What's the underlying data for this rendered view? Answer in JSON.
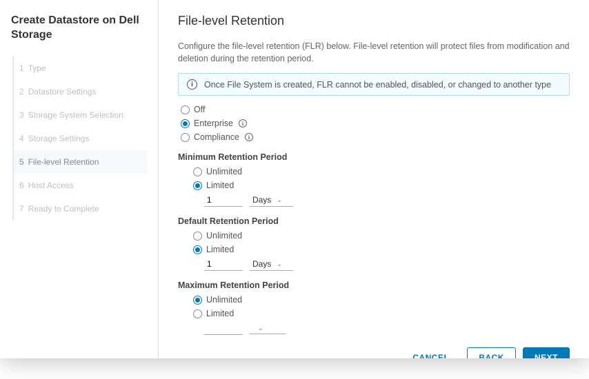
{
  "wizard_title": "Create Datastore on Dell Storage",
  "steps": [
    {
      "num": "1",
      "label": "Type"
    },
    {
      "num": "2",
      "label": "Datastore Settings"
    },
    {
      "num": "3",
      "label": "Storage System Selection"
    },
    {
      "num": "4",
      "label": "Storage Settings"
    },
    {
      "num": "5",
      "label": "File-level Retention"
    },
    {
      "num": "6",
      "label": "Host Access"
    },
    {
      "num": "7",
      "label": "Ready to Complete"
    }
  ],
  "page": {
    "title": "File-level Retention",
    "description": "Configure the file-level retention (FLR) below. File-level retention will protect files from modification and deletion during the retention period.",
    "info_banner": "Once File System is created, FLR cannot be enabled, disabled, or changed to another type"
  },
  "flr_mode": {
    "off": "Off",
    "enterprise": "Enterprise",
    "compliance": "Compliance"
  },
  "min_period": {
    "label": "Minimum Retention Period",
    "unlimited": "Unlimited",
    "limited": "Limited",
    "value": "1",
    "unit": "Days"
  },
  "default_period": {
    "label": "Default Retention Period",
    "unlimited": "Unlimited",
    "limited": "Limited",
    "value": "1",
    "unit": "Days"
  },
  "max_period": {
    "label": "Maximum Retention Period",
    "unlimited": "Unlimited",
    "limited": "Limited",
    "value": "",
    "unit": ""
  },
  "footer": {
    "cancel": "Cancel",
    "back": "Back",
    "next": "Next"
  }
}
